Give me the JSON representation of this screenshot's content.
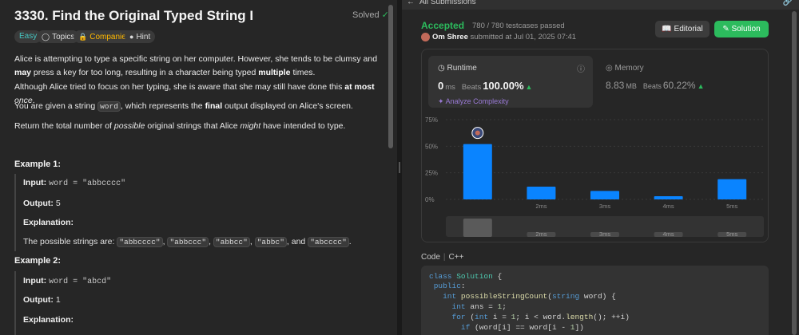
{
  "problem": {
    "title": "3330. Find the Original Typed String I",
    "solved_label": "Solved",
    "tags": {
      "easy": "Easy",
      "topics": "Topics",
      "companies": "Companies",
      "hint": "Hint"
    },
    "p1": {
      "a": "Alice is attempting to type a specific string on her computer. However, she tends to be clumsy and ",
      "b": "may",
      "c": " press a key for too long, resulting in a character being typed ",
      "d": "multiple",
      "e": " times."
    },
    "p2": {
      "a": "Although Alice tried to focus on her typing, she is aware that she may still have done this ",
      "b": "at most",
      "c": " ",
      "d": "once",
      "e": "."
    },
    "p3": {
      "a": "You are given a string ",
      "code": "word",
      "b": ", which represents the ",
      "c": "final",
      "d": " output displayed on Alice's screen."
    },
    "p4": {
      "a": "Return the total number of ",
      "b": "possible",
      "c": " original strings that Alice ",
      "d": "might",
      "e": " have intended to type."
    },
    "example1": {
      "title": "Example 1:",
      "input_label": "Input:",
      "input": "word = \"abbcccc\"",
      "output_label": "Output:",
      "output": "5",
      "explanation_label": "Explanation:",
      "explanation_prefix": "The possible strings are: ",
      "strings": [
        "\"abbcccc\"",
        "\"abbccc\"",
        "\"abbcc\"",
        "\"abbc\"",
        "\"abcccc\""
      ],
      "sep": ", ",
      "and": ", and ",
      "end": "."
    },
    "example2": {
      "title": "Example 2:",
      "input_label": "Input:",
      "input": "word = \"abcd\"",
      "output_label": "Output:",
      "output": "1",
      "explanation_label": "Explanation:"
    }
  },
  "submission": {
    "back_label": "All Submissions",
    "status": "Accepted",
    "testcases": "780 / 780 testcases passed",
    "author": "Om Shree",
    "submitted": "submitted at Jul 01, 2025 07:41",
    "editorial_label": "Editorial",
    "solution_label": "Solution",
    "runtime": {
      "label": "Runtime",
      "value": "0",
      "unit": "ms",
      "beats_label": "Beats",
      "beats": "100.00%",
      "analyze": "Analyze Complexity"
    },
    "memory": {
      "label": "Memory",
      "value": "8.83",
      "unit": "MB",
      "beats_label": "Beats",
      "beats": "60.22%"
    },
    "code_lang_label": "Code",
    "code_lang": "C++",
    "code_lines": [
      "class Solution {",
      "public:",
      "    int possibleStringCount(string word) {",
      "        int ans = 1;",
      "        for (int i = 1; i < word.length(); ++i)",
      "            if (word[i] == word[i - 1])"
    ]
  },
  "chart_data": {
    "type": "bar",
    "categories": [
      "",
      "2ms",
      "3ms",
      "4ms",
      "5ms"
    ],
    "values": [
      52,
      12,
      8,
      3,
      19
    ],
    "ylim": [
      0,
      75
    ],
    "yticks": [
      "0%",
      "25%",
      "50%",
      "75%"
    ],
    "ytick_values": [
      0,
      25,
      50,
      75
    ],
    "bar_color": "#0a84ff",
    "grid": true,
    "mini_labels": [
      "2ms",
      "3ms",
      "4ms",
      "5ms"
    ]
  },
  "colors": {
    "accent_green": "#2cbb5d",
    "bar_blue": "#0a84ff",
    "easy_teal": "#46c6c2",
    "companies_yellow": "#ffb800"
  }
}
